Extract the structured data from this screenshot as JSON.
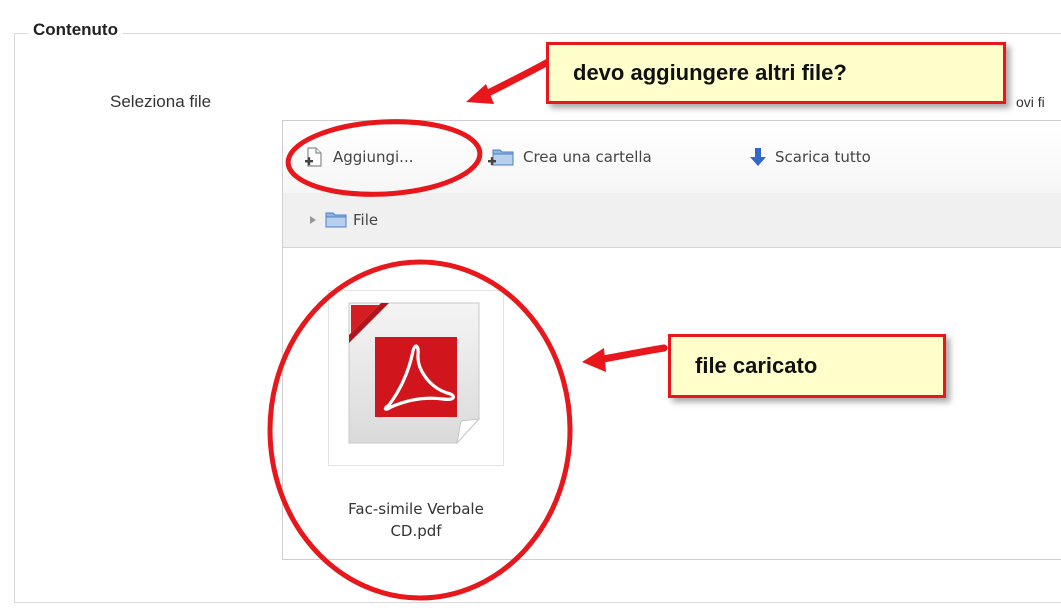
{
  "section": {
    "legend": "Contenuto"
  },
  "field": {
    "label": "Seleziona file",
    "truncated_text": "ovi fi"
  },
  "toolbar": {
    "add_label": "Aggiungi...",
    "mkdir_label": "Crea una cartella",
    "download_label": "Scarica tutto",
    "add_icon": "file-add-icon",
    "mkdir_icon": "folder-add-icon",
    "download_icon": "arrow-down-icon"
  },
  "path": {
    "expand_icon": "triangle-right-icon",
    "folder_icon": "folder-icon",
    "label": "File"
  },
  "files": [
    {
      "name": "Fac-simile Verbale CD.pdf",
      "name_line1": "Fac-simile Verbale",
      "name_line2": "CD.pdf",
      "icon": "pdf-icon"
    }
  ],
  "annotations": {
    "callout1": "devo aggiungere altri file?",
    "callout2": "file caricato",
    "color": "#e8171b",
    "fill": "#ffffcc"
  }
}
